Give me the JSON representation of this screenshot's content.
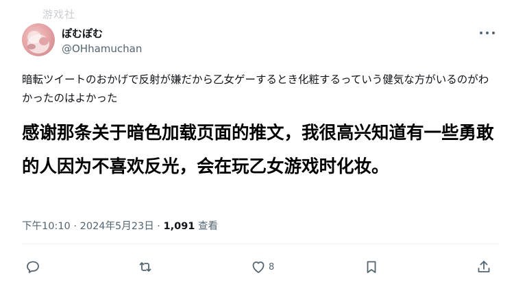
{
  "watermark": "游戏社",
  "user": {
    "display_name": "ぽむぽむ",
    "handle": "@OHhamuchan"
  },
  "tweet": {
    "original_text": "暗転ツイートのおかげで反射が嫌だから乙女ゲーするとき化粧するっていう健気な方がいるのがわかったのはよかった",
    "translation_text": "感谢那条关于暗色加载页面的推文，我很高兴知道有一些勇敢的人因为不喜欢反光，会在玩乙女游戏时化妆。"
  },
  "meta": {
    "time": "下午10:10",
    "sep1": " · ",
    "date": "2024年5月23日",
    "sep2": " · ",
    "views_count": "1,091",
    "views_label": " 查看"
  },
  "actions": {
    "likes_count": "8"
  },
  "colors": {
    "text_primary": "#0f1419",
    "text_secondary": "#536471",
    "divider": "#eff3f4"
  },
  "icons": [
    "more-icon",
    "reply-icon",
    "retweet-icon",
    "like-icon",
    "bookmark-icon",
    "share-icon"
  ]
}
